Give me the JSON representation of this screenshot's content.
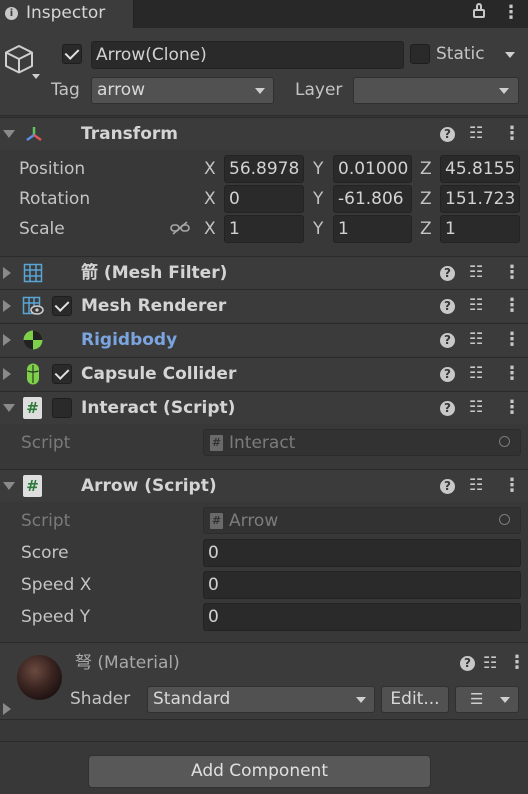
{
  "tab": {
    "title": "Inspector"
  },
  "object": {
    "name": "Arrow(Clone)",
    "active": true,
    "static_label": "Static",
    "tag_label": "Tag",
    "tag_value": "arrow",
    "layer_label": "Layer",
    "layer_value": ""
  },
  "transform": {
    "title": "Transform",
    "position": {
      "label": "Position",
      "x": "56.8978",
      "y": "0.01000",
      "z": "45.8155"
    },
    "rotation": {
      "label": "Rotation",
      "x": "0",
      "y": "-61.806",
      "z": "151.723"
    },
    "scale": {
      "label": "Scale",
      "x": "1",
      "y": "1",
      "z": "1"
    },
    "axis_x": "X",
    "axis_y": "Y",
    "axis_z": "Z"
  },
  "components": {
    "mesh_filter": "箭 (Mesh Filter)",
    "mesh_renderer": "Mesh Renderer",
    "rigidbody": "Rigidbody",
    "capsule_collider": "Capsule Collider",
    "interact": "Interact (Script)"
  },
  "interact_script": {
    "label": "Script",
    "value": "Interact"
  },
  "arrow_script": {
    "title": "Arrow (Script)",
    "script_label": "Script",
    "script_value": "Arrow",
    "score_label": "Score",
    "score_value": "0",
    "speedx_label": "Speed X",
    "speedx_value": "0",
    "speedy_label": "Speed Y",
    "speedy_value": "0"
  },
  "material": {
    "name": "弩 (Material)",
    "shader_label": "Shader",
    "shader_value": "Standard",
    "edit_label": "Edit..."
  },
  "add_component": "Add Component",
  "colors": {
    "accent_blue": "#7aa5e0",
    "panel": "#383838",
    "header": "#3b3b3b",
    "tab": "#3c3c3c"
  }
}
